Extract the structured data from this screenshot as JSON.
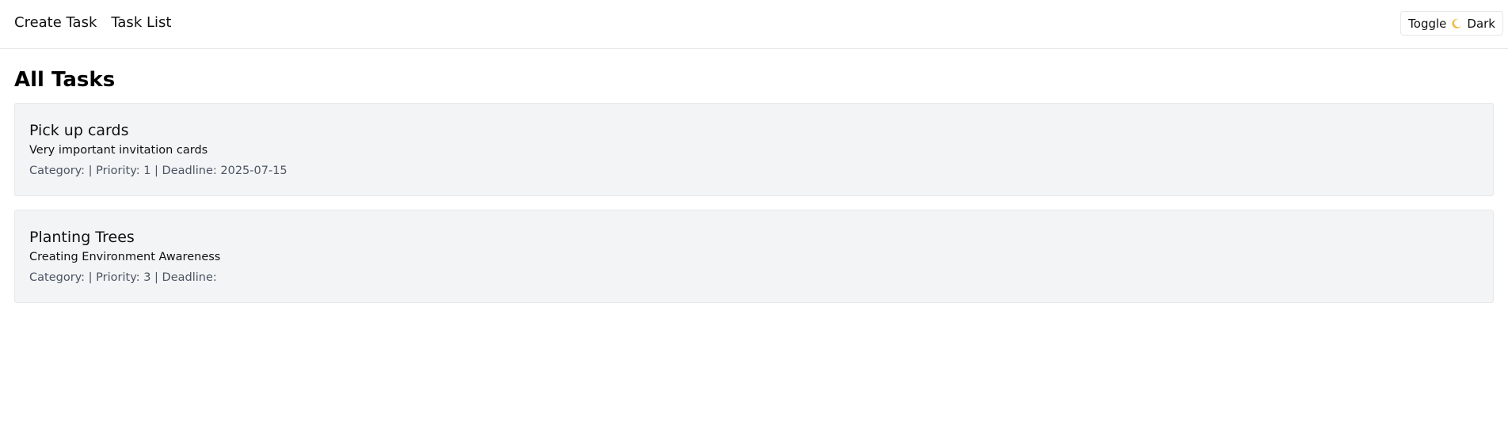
{
  "nav": {
    "links": [
      "Create Task",
      "Task List"
    ],
    "toggle": {
      "prefix": "Toggle",
      "icon": "moon-icon",
      "suffix": "Dark"
    }
  },
  "main": {
    "title": "All Tasks",
    "tasks": [
      {
        "title": "Pick up cards",
        "description": "Very important invitation cards",
        "meta": "Category: | Priority: 1 | Deadline: 2025-07-15"
      },
      {
        "title": "Planting Trees",
        "description": "Creating Environment Awareness",
        "meta": "Category: | Priority: 3 | Deadline:"
      }
    ]
  },
  "colors": {
    "card_bg": "#f3f4f6",
    "border": "#e5e7eb",
    "meta_text": "#4b5563",
    "moon": "#f5b942"
  }
}
